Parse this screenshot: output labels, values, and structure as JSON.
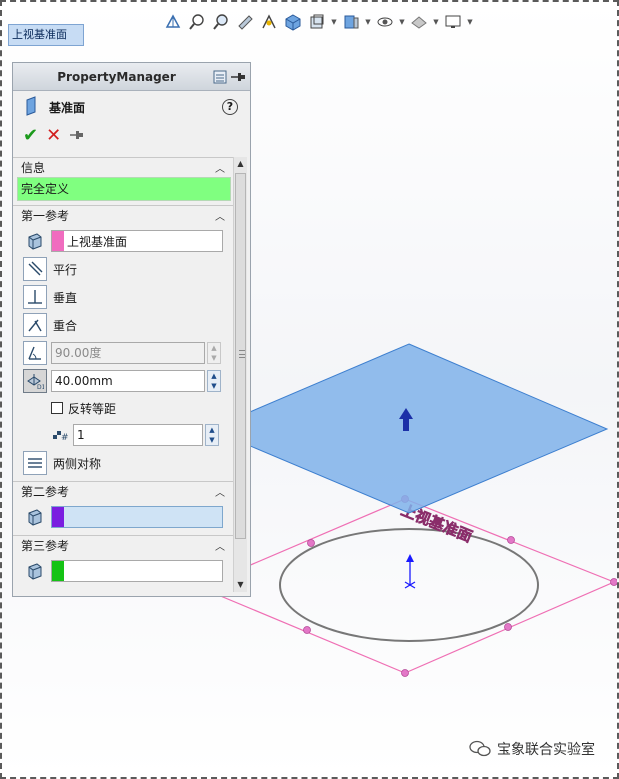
{
  "breadcrumb": {
    "label": "上视基准面"
  },
  "property_manager": {
    "title": "PropertyManager",
    "feature_title": "基准面",
    "help": "?",
    "sections": {
      "info": {
        "label": "信息",
        "status": "完全定义"
      },
      "first_ref": {
        "label": "第一参考",
        "reference": "上视基准面",
        "options": {
          "parallel": "平行",
          "perpendicular": "垂直",
          "coincident": "重合"
        },
        "angle_value": "90.00度",
        "offset_value": "40.00mm",
        "flip_offset": "反转等距",
        "count_value": "1",
        "mid_plane": "两侧对称"
      },
      "second_ref": {
        "label": "第二参考",
        "reference": ""
      },
      "third_ref": {
        "label": "第三参考",
        "reference": ""
      }
    }
  },
  "viewport": {
    "plane_label": "上视基准面"
  },
  "watermark": {
    "text": "宝象联合实验室"
  },
  "colors": {
    "plane_fill": "#7fb2ea",
    "plane_edge": "#3d7fcf",
    "ref_plane_edge": "#ef6fb4",
    "status_green": "#80ff80",
    "first_swatch": "#f06cbf",
    "second_swatch": "#7a1de0",
    "third_swatch": "#15c315"
  }
}
